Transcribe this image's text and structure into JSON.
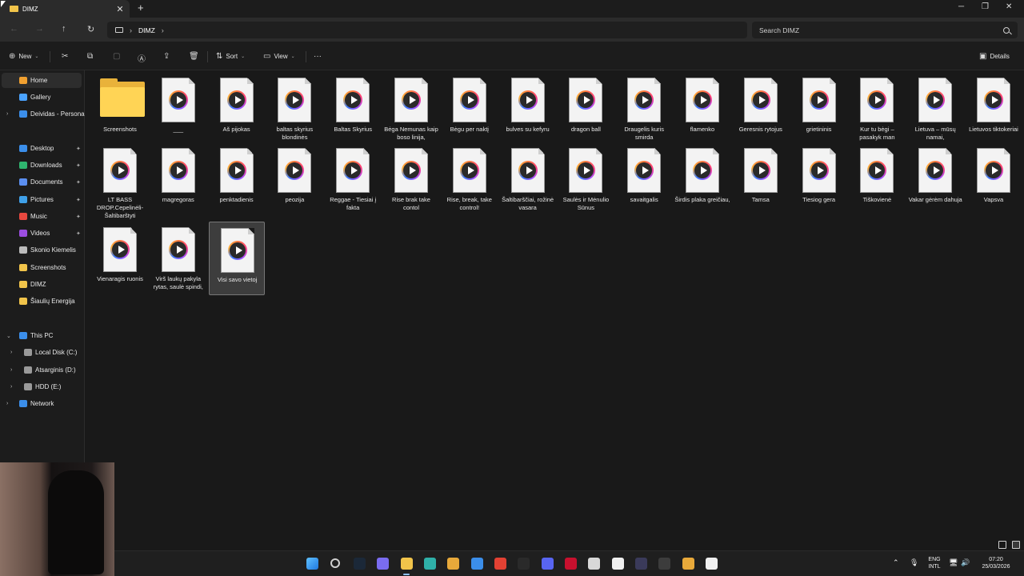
{
  "window": {
    "tab_title": "DIMZ",
    "tab_close": "✕",
    "new_tab": "+",
    "minimize": "─",
    "maximize": "❐",
    "close": "✕"
  },
  "nav": {
    "back": "←",
    "forward": "→",
    "up": "↑",
    "refresh": "↻",
    "breadcrumb": "DIMZ",
    "crumb_chevron": "›",
    "search_placeholder": "Search DIMZ"
  },
  "commands": {
    "new": "New",
    "sort": "Sort",
    "view": "View",
    "more": "···",
    "details": "Details",
    "new_icon": "⊕",
    "cut_icon": "✂",
    "copy_icon": "⧉",
    "paste_icon": "▢",
    "rename_icon": "Ⓐ",
    "share_icon": "⇪",
    "delete_icon": "🗑",
    "sort_icon": "⇅",
    "view_icon": "▭",
    "details_icon": "▣",
    "caret": "⌄"
  },
  "sidebar": {
    "items": [
      {
        "label": "Home",
        "icon": "home-icon",
        "color": "#f0a030"
      },
      {
        "label": "Gallery",
        "icon": "gallery-icon",
        "color": "#4aa3ff"
      },
      {
        "label": "Deividas - Personal",
        "icon": "onedrive-icon",
        "color": "#3b8eea"
      },
      {
        "label": "Desktop",
        "icon": "desktop-icon",
        "color": "#3b8eea"
      },
      {
        "label": "Downloads",
        "icon": "downloads-icon",
        "color": "#2fb56f"
      },
      {
        "label": "Documents",
        "icon": "documents-icon",
        "color": "#5b8ff0"
      },
      {
        "label": "Pictures",
        "icon": "pictures-icon",
        "color": "#3fa0e8"
      },
      {
        "label": "Music",
        "icon": "music-icon",
        "color": "#e8483f"
      },
      {
        "label": "Videos",
        "icon": "videos-icon",
        "color": "#9b4de0"
      },
      {
        "label": "Skonio Kiemelis",
        "icon": "file-icon",
        "color": "#bbbbbb"
      },
      {
        "label": "Screenshots",
        "icon": "folder-icon",
        "color": "#f1c44a"
      },
      {
        "label": "DIMZ",
        "icon": "folder-icon",
        "color": "#f1c44a"
      },
      {
        "label": "Šiaulių Energija",
        "icon": "folder-icon",
        "color": "#f1c44a"
      },
      {
        "label": "This PC",
        "icon": "this-pc-icon",
        "color": "#3b8eea"
      },
      {
        "label": "Local Disk (C:)",
        "icon": "drive-icon",
        "color": "#9a9a9a"
      },
      {
        "label": "Atsarginis (D:)",
        "icon": "drive-icon",
        "color": "#9a9a9a"
      },
      {
        "label": "HDD (E:)",
        "icon": "drive-icon",
        "color": "#9a9a9a"
      },
      {
        "label": "Network",
        "icon": "network-icon",
        "color": "#3b8eea"
      }
    ],
    "pin_glyph": "📌",
    "expand_glyph": "›",
    "expanded_glyph": "⌄"
  },
  "files": [
    {
      "name": "Screenshots",
      "type": "folder"
    },
    {
      "name": "___",
      "type": "video"
    },
    {
      "name": "Aš pijokas",
      "type": "video"
    },
    {
      "name": "baltas skyrius blondinės",
      "type": "video"
    },
    {
      "name": "Baltas Skyrius",
      "type": "video"
    },
    {
      "name": "Bėga Nemunas kaip boso linija,",
      "type": "video"
    },
    {
      "name": "Bėgu per naktį",
      "type": "video"
    },
    {
      "name": "bulves su kefyru",
      "type": "video"
    },
    {
      "name": "dragon ball",
      "type": "video"
    },
    {
      "name": "Draugelis kuris smirda",
      "type": "video"
    },
    {
      "name": "flamenko",
      "type": "video"
    },
    {
      "name": "Geresnis rytojus",
      "type": "video"
    },
    {
      "name": "grietininis",
      "type": "video"
    },
    {
      "name": "Kur tu bėgi – pasakyk man",
      "type": "video"
    },
    {
      "name": "Lietuva – mūsų namai,",
      "type": "video"
    },
    {
      "name": "Lietuvos tiktokeriai",
      "type": "video"
    },
    {
      "name": "LT BASS DROP.Cepelinėli-Šaltibarštyti",
      "type": "video"
    },
    {
      "name": "magregoras",
      "type": "video"
    },
    {
      "name": "penktadienis",
      "type": "video"
    },
    {
      "name": "peozija",
      "type": "video"
    },
    {
      "name": "Reggae - Tiesiai į fakta",
      "type": "video"
    },
    {
      "name": "Rise brak take contol",
      "type": "video"
    },
    {
      "name": "Rise, break, take control!",
      "type": "video"
    },
    {
      "name": "Šaltibarščiai, rožinė vasara",
      "type": "video"
    },
    {
      "name": "Saulės ir Mėnulio Sūnus",
      "type": "video"
    },
    {
      "name": "savaitgalis",
      "type": "video"
    },
    {
      "name": "Širdis plaka greičiau,",
      "type": "video"
    },
    {
      "name": "Tamsa",
      "type": "video"
    },
    {
      "name": "Tiesiog gera",
      "type": "video"
    },
    {
      "name": "Tiškovienė",
      "type": "video"
    },
    {
      "name": "Vakar gėrėm dahuja",
      "type": "video"
    },
    {
      "name": "Vapsva",
      "type": "video"
    },
    {
      "name": "Vienaragis ruonis",
      "type": "video"
    },
    {
      "name": "Virš laukų pakyla rytas, saulė spindi,",
      "type": "video"
    },
    {
      "name": "Visi savo vietoj",
      "type": "video",
      "selected": true
    }
  ],
  "taskbar": {
    "apps": [
      {
        "icon": "start-icon",
        "color": "#3a9bf2"
      },
      {
        "icon": "search-icon",
        "color": "#d0d0d0"
      },
      {
        "icon": "steam-icon",
        "color": "#1b2838"
      },
      {
        "icon": "copilot-icon",
        "color": "#7a6cf0"
      },
      {
        "icon": "file-explorer-icon",
        "color": "#f1c44a"
      },
      {
        "icon": "edge-icon",
        "color": "#2fb0a8"
      },
      {
        "icon": "store-icon",
        "color": "#e8a93a"
      },
      {
        "icon": "mail-icon",
        "color": "#3b8eea"
      },
      {
        "icon": "chrome-icon",
        "color": "#e34133"
      },
      {
        "icon": "epic-games-icon",
        "color": "#2a2a2a"
      },
      {
        "icon": "discord-icon",
        "color": "#5865f2"
      },
      {
        "icon": "app-red-icon",
        "color": "#c8102e"
      },
      {
        "icon": "capcut-icon",
        "color": "#d8d8d8"
      },
      {
        "icon": "document-icon",
        "color": "#f0f0f0"
      },
      {
        "icon": "game-icon",
        "color": "#3a3a5a"
      },
      {
        "icon": "obs-icon",
        "color": "#3c3c3c"
      },
      {
        "icon": "chrome-alt-icon",
        "color": "#e8a93a"
      },
      {
        "icon": "media-player-icon",
        "color": "#f0f0f0"
      }
    ],
    "tray": {
      "chevron": "⌃",
      "lang": "ENG",
      "layout": "INTL",
      "time": "07:20",
      "date": "25/03/2026"
    }
  }
}
